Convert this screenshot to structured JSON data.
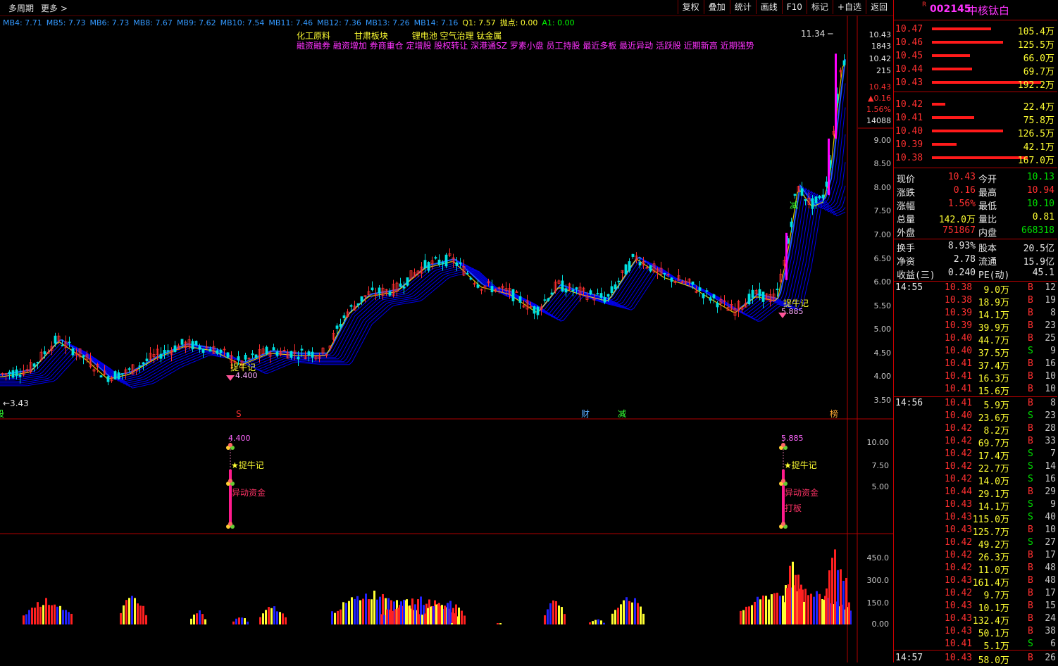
{
  "toolbar": {
    "left": [
      "多周期",
      "更多 >"
    ],
    "buttons": [
      "复权",
      "叠加",
      "统计",
      "画线",
      "F10",
      "标记",
      "+自选",
      "返回"
    ]
  },
  "ma_line": [
    {
      "text": "MB4: 7.71",
      "color": "#3399ff"
    },
    {
      "text": "MB5: 7.73",
      "color": "#3399ff"
    },
    {
      "text": "MB6: 7.73",
      "color": "#3399ff"
    },
    {
      "text": "MB8: 7.67",
      "color": "#3399ff"
    },
    {
      "text": "MB9: 7.62",
      "color": "#3399ff"
    },
    {
      "text": "MB10: 7.54",
      "color": "#3399ff"
    },
    {
      "text": "MB11: 7.46",
      "color": "#3399ff"
    },
    {
      "text": "MB12: 7.36",
      "color": "#3399ff"
    },
    {
      "text": "MB13: 7.26",
      "color": "#3399ff"
    },
    {
      "text": "MB14: 7.16",
      "color": "#3399ff"
    },
    {
      "text": "Q1: 7.57",
      "color": "#ffff33"
    },
    {
      "text": "抛点: 0.00",
      "color": "#ffff33"
    },
    {
      "text": "A1: 0.00",
      "color": "#00ff00"
    }
  ],
  "concepts_line1": [
    "化工原料",
    "甘肃板块",
    "锂电池 空气治理 钛金属"
  ],
  "concepts_line2": "融资融券 融资增加 券商重仓 定增股 股权转让 深港通SZ 罗素小盘 员工持股 最近多板 最近异动 活跃股 近期新高 近期强势",
  "chart_labels": {
    "high_marker": "11.34",
    "low_marker": "3.43",
    "signal1": "捉牛记",
    "signal1_price": "4.400",
    "signal2": "捉牛记",
    "signal2_price": "5.885",
    "event_s": "S",
    "event_cai": "财",
    "event_jian": "减",
    "event_bang": "榜",
    "event_jian2": "减",
    "event_left": "股"
  },
  "price_axis": [
    "10.43",
    "1843",
    "10.42",
    "215",
    "10.43",
    "▲0.16",
    "1.56%",
    "14088",
    "9.00",
    "8.50",
    "8.00",
    "7.50",
    "7.00",
    "6.50",
    "6.00",
    "5.50",
    "5.00",
    "4.50",
    "4.00",
    "3.50"
  ],
  "sub1_axis": [
    "10.00",
    "7.50",
    "5.00"
  ],
  "sub1_labels": {
    "p1": "4.400",
    "p2": "5.885",
    "star1": "★捉牛记",
    "star2": "★捉牛记",
    "fund1": "异动资金",
    "fund2": "异动资金",
    "board": "打板"
  },
  "sub2_axis": [
    "450.0",
    "300.0",
    "150.0",
    "0.00"
  ],
  "stock": {
    "flag": "R",
    "code": "002145",
    "name": "中核钛白"
  },
  "asks": [
    {
      "price": "10.47",
      "vol": "105.4万",
      "bar": 0.31
    },
    {
      "price": "10.46",
      "vol": "125.5万",
      "bar": 0.37
    },
    {
      "price": "10.45",
      "vol": "66.0万",
      "bar": 0.2
    },
    {
      "price": "10.44",
      "vol": "69.7万",
      "bar": 0.21
    },
    {
      "price": "10.43",
      "vol": "192.2万",
      "bar": 0.57
    }
  ],
  "bids": [
    {
      "price": "10.42",
      "vol": "22.4万",
      "bar": 0.07
    },
    {
      "price": "10.41",
      "vol": "75.8万",
      "bar": 0.22
    },
    {
      "price": "10.40",
      "vol": "126.5万",
      "bar": 0.37
    },
    {
      "price": "10.39",
      "vol": "42.1万",
      "bar": 0.13
    },
    {
      "price": "10.38",
      "vol": "167.0万",
      "bar": 0.5
    }
  ],
  "quote": [
    {
      "l": "现价",
      "v": "10.43",
      "vc": "red",
      "l2": "今开",
      "v2": "10.13",
      "v2c": "green"
    },
    {
      "l": "涨跌",
      "v": "0.16",
      "vc": "red",
      "l2": "最高",
      "v2": "10.94",
      "v2c": "red"
    },
    {
      "l": "涨幅",
      "v": "1.56%",
      "vc": "red",
      "l2": "最低",
      "v2": "10.10",
      "v2c": "green"
    },
    {
      "l": "总量",
      "v": "142.0万",
      "vc": "yellow",
      "l2": "量比",
      "v2": "0.81",
      "v2c": "yellow"
    },
    {
      "l": "外盘",
      "v": "751867",
      "vc": "red",
      "l2": "内盘",
      "v2": "668318",
      "v2c": "green"
    }
  ],
  "quote2": [
    {
      "l": "换手",
      "v": "8.93%",
      "l2": "股本",
      "v2": "20.5亿"
    },
    {
      "l": "净资",
      "v": "2.78",
      "l2": "流通",
      "v2": "15.9亿"
    },
    {
      "l": "收益(三)",
      "v": "0.240",
      "l2": "PE(动)",
      "v2": "45.1"
    }
  ],
  "ticks": [
    {
      "time": "14:55",
      "price": "10.38",
      "vol": "9.0万",
      "bs": "B",
      "n": "12"
    },
    {
      "time": "",
      "price": "10.38",
      "vol": "18.9万",
      "bs": "B",
      "n": "19"
    },
    {
      "time": "",
      "price": "10.39",
      "vol": "14.1万",
      "bs": "B",
      "n": "8"
    },
    {
      "time": "",
      "price": "10.39",
      "vol": "39.9万",
      "bs": "B",
      "n": "23"
    },
    {
      "time": "",
      "price": "10.40",
      "vol": "44.7万",
      "bs": "B",
      "n": "25"
    },
    {
      "time": "",
      "price": "10.40",
      "vol": "37.5万",
      "bs": "S",
      "n": "9"
    },
    {
      "time": "",
      "price": "10.41",
      "vol": "37.4万",
      "bs": "B",
      "n": "16"
    },
    {
      "time": "",
      "price": "10.41",
      "vol": "16.3万",
      "bs": "B",
      "n": "10"
    },
    {
      "time": "",
      "price": "10.41",
      "vol": "15.6万",
      "bs": "B",
      "n": "10"
    },
    {
      "time": "14:56",
      "price": "10.41",
      "vol": "5.9万",
      "bs": "B",
      "n": "8"
    },
    {
      "time": "",
      "price": "10.40",
      "vol": "23.6万",
      "bs": "S",
      "n": "23"
    },
    {
      "time": "",
      "price": "10.42",
      "vol": "8.2万",
      "bs": "B",
      "n": "28"
    },
    {
      "time": "",
      "price": "10.42",
      "vol": "69.7万",
      "bs": "B",
      "n": "33"
    },
    {
      "time": "",
      "price": "10.42",
      "vol": "17.4万",
      "bs": "S",
      "n": "7"
    },
    {
      "time": "",
      "price": "10.42",
      "vol": "22.7万",
      "bs": "S",
      "n": "14"
    },
    {
      "time": "",
      "price": "10.42",
      "vol": "14.0万",
      "bs": "S",
      "n": "16"
    },
    {
      "time": "",
      "price": "10.44",
      "vol": "29.1万",
      "bs": "B",
      "n": "29"
    },
    {
      "time": "",
      "price": "10.43",
      "vol": "14.1万",
      "bs": "S",
      "n": "9"
    },
    {
      "time": "",
      "price": "10.43",
      "vol": "115.0万",
      "bs": "S",
      "n": "40"
    },
    {
      "time": "",
      "price": "10.43",
      "vol": "125.7万",
      "bs": "B",
      "n": "10"
    },
    {
      "time": "",
      "price": "10.42",
      "vol": "49.2万",
      "bs": "S",
      "n": "27"
    },
    {
      "time": "",
      "price": "10.42",
      "vol": "26.3万",
      "bs": "B",
      "n": "17"
    },
    {
      "time": "",
      "price": "10.42",
      "vol": "11.0万",
      "bs": "B",
      "n": "48"
    },
    {
      "time": "",
      "price": "10.43",
      "vol": "161.4万",
      "bs": "B",
      "n": "48"
    },
    {
      "time": "",
      "price": "10.42",
      "vol": "9.7万",
      "bs": "B",
      "n": "17"
    },
    {
      "time": "",
      "price": "10.43",
      "vol": "10.1万",
      "bs": "B",
      "n": "15"
    },
    {
      "time": "",
      "price": "10.43",
      "vol": "132.4万",
      "bs": "B",
      "n": "24"
    },
    {
      "time": "",
      "price": "10.43",
      "vol": "50.1万",
      "bs": "B",
      "n": "38"
    },
    {
      "time": "",
      "price": "10.41",
      "vol": "5.1万",
      "bs": "S",
      "n": "6"
    },
    {
      "time": "14:57",
      "price": "10.43",
      "vol": "58.0万",
      "bs": "B",
      "n": "26"
    }
  ],
  "colors": {
    "up": "#ff3030",
    "down": "#00e0e0",
    "ma": "#0000ff",
    "accent": "#ff33ff"
  }
}
